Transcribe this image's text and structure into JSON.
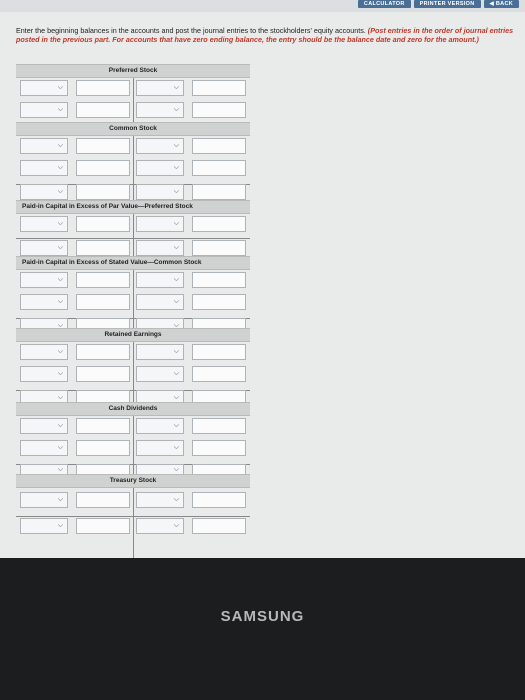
{
  "toolbar": {
    "calculator": "CALCULATOR",
    "printer_version": "PRINTER VERSION",
    "back": "◀ BACK"
  },
  "instructions": {
    "text": "Enter the beginning balances in the accounts and post the journal entries to the stockholders' equity accounts.",
    "note": "(Post entries in the order of journal entries posted in the previous part. For accounts that have zero ending balance, the entry should be the balance date and zero for the amount.)"
  },
  "sections": [
    {
      "title": "Preferred Stock"
    },
    {
      "title": "Common Stock"
    },
    {
      "title": "Paid-in Capital in Excess of Par Value—Preferred Stock"
    },
    {
      "title": "Paid-in Capital in Excess of Stated Value—Common Stock"
    },
    {
      "title": "Retained Earnings"
    },
    {
      "title": "Cash Dividends"
    },
    {
      "title": "Treasury Stock"
    }
  ],
  "brand": {
    "text": "SAMSUNG"
  }
}
